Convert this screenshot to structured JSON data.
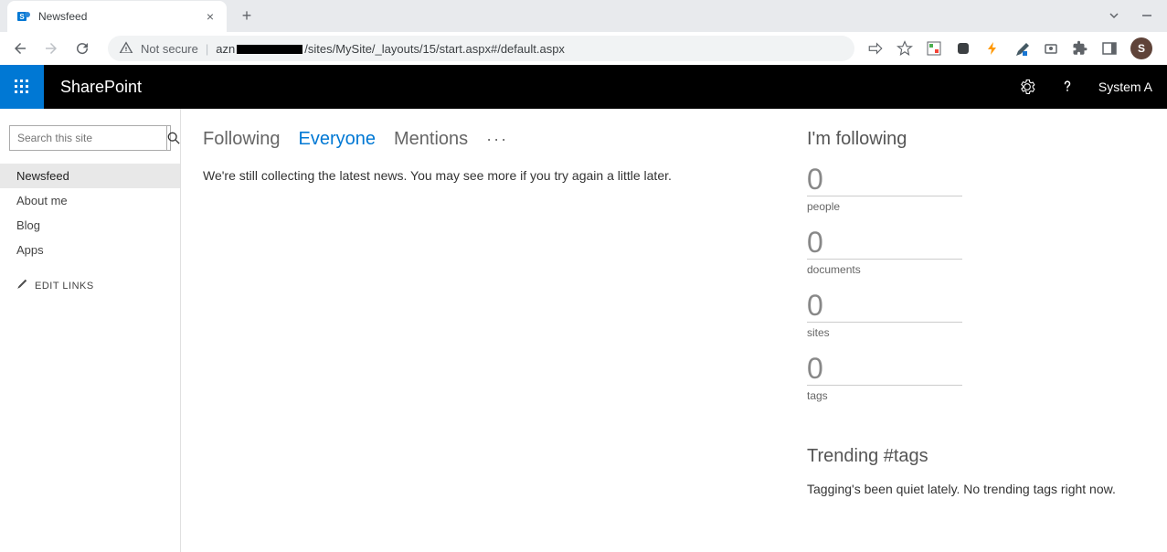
{
  "browser": {
    "tab_title": "Newsfeed",
    "not_secure": "Not secure",
    "url_prefix": "azn",
    "url_suffix": "/sites/MySite/_layouts/15/start.aspx#/default.aspx",
    "avatar_letter": "S"
  },
  "header": {
    "brand": "SharePoint",
    "user": "System A"
  },
  "sidebar": {
    "search_placeholder": "Search this site",
    "items": [
      {
        "label": "Newsfeed",
        "active": true
      },
      {
        "label": "About me",
        "active": false
      },
      {
        "label": "Blog",
        "active": false
      },
      {
        "label": "Apps",
        "active": false
      }
    ],
    "edit_links": "EDIT LINKS"
  },
  "main": {
    "tabs": [
      {
        "label": "Following",
        "selected": false
      },
      {
        "label": "Everyone",
        "selected": true
      },
      {
        "label": "Mentions",
        "selected": false
      }
    ],
    "status": "We're still collecting the latest news. You may see more if you try again a little later."
  },
  "side": {
    "following_heading": "I'm following",
    "following": [
      {
        "count": "0",
        "label": "people"
      },
      {
        "count": "0",
        "label": "documents"
      },
      {
        "count": "0",
        "label": "sites"
      },
      {
        "count": "0",
        "label": "tags"
      }
    ],
    "trending_heading": "Trending #tags",
    "trending_text": "Tagging's been quiet lately. No trending tags right now."
  }
}
